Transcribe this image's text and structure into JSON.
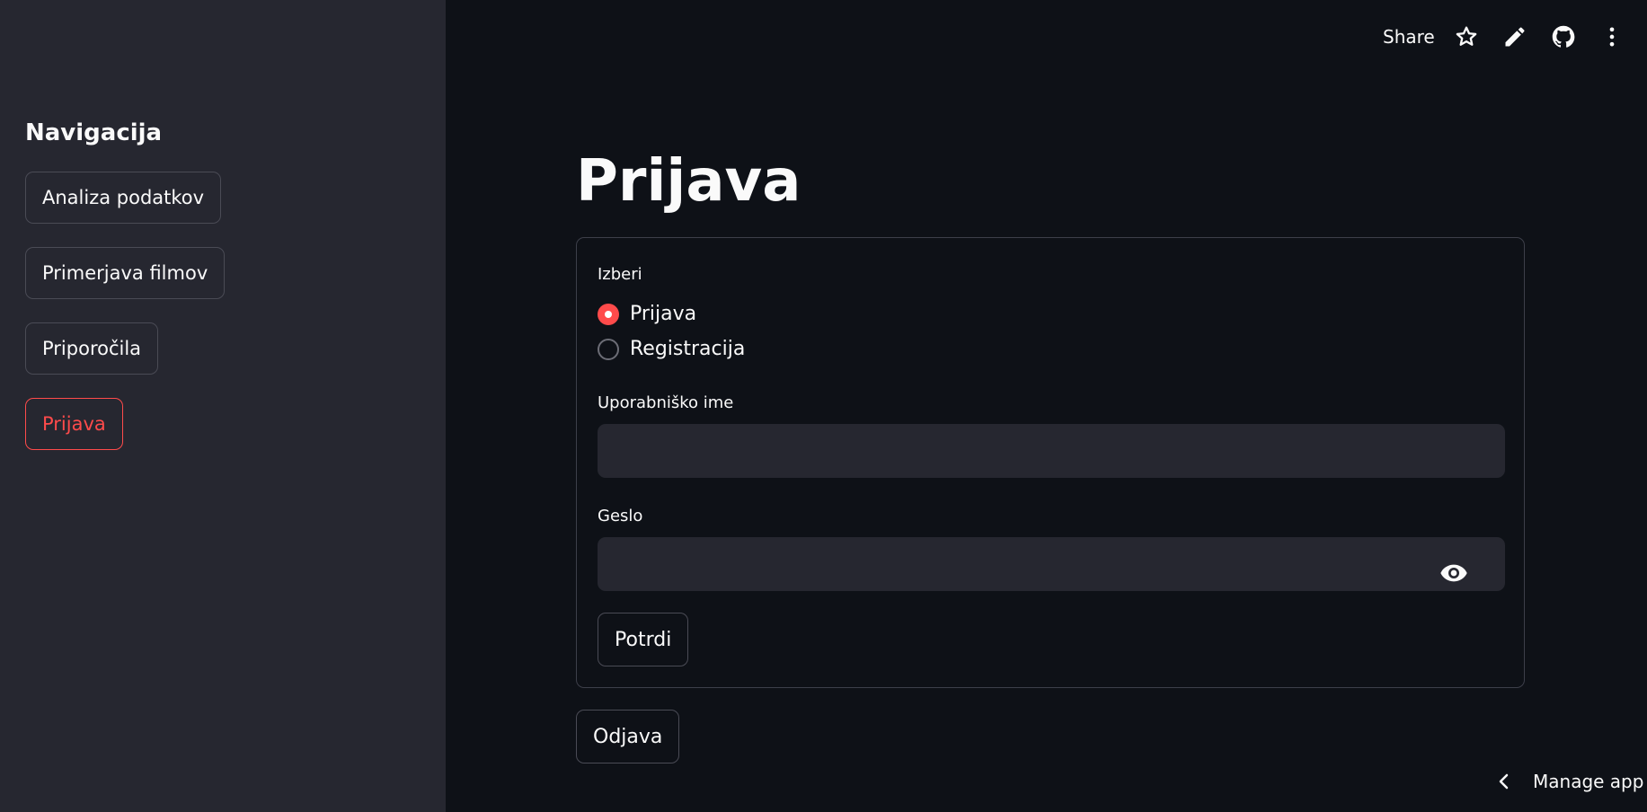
{
  "sidebar": {
    "heading": "Navigacija",
    "items": [
      {
        "label": "Analiza podatkov"
      },
      {
        "label": "Primerjava filmov"
      },
      {
        "label": "Priporočila"
      },
      {
        "label": "Prijava"
      }
    ]
  },
  "toolbar": {
    "share_label": "Share",
    "icons": [
      "star-icon",
      "pencil-icon",
      "github-icon",
      "more-vertical-icon"
    ]
  },
  "main": {
    "title": "Prijava",
    "radio": {
      "label": "Izberi",
      "options": [
        "Prijava",
        "Registracija"
      ],
      "selected": "Prijava"
    },
    "username": {
      "label": "Uporabniško ime",
      "value": "",
      "placeholder": ""
    },
    "password": {
      "label": "Geslo",
      "value": "",
      "placeholder": ""
    },
    "submit_label": "Potrdi",
    "logout_label": "Odjava"
  },
  "footer": {
    "manage_label": "Manage app"
  },
  "colors": {
    "accent": "#ff4b4b",
    "background": "#0e1117",
    "sidebar_background": "#262730",
    "input_background": "#262730",
    "text": "#fafafa"
  }
}
